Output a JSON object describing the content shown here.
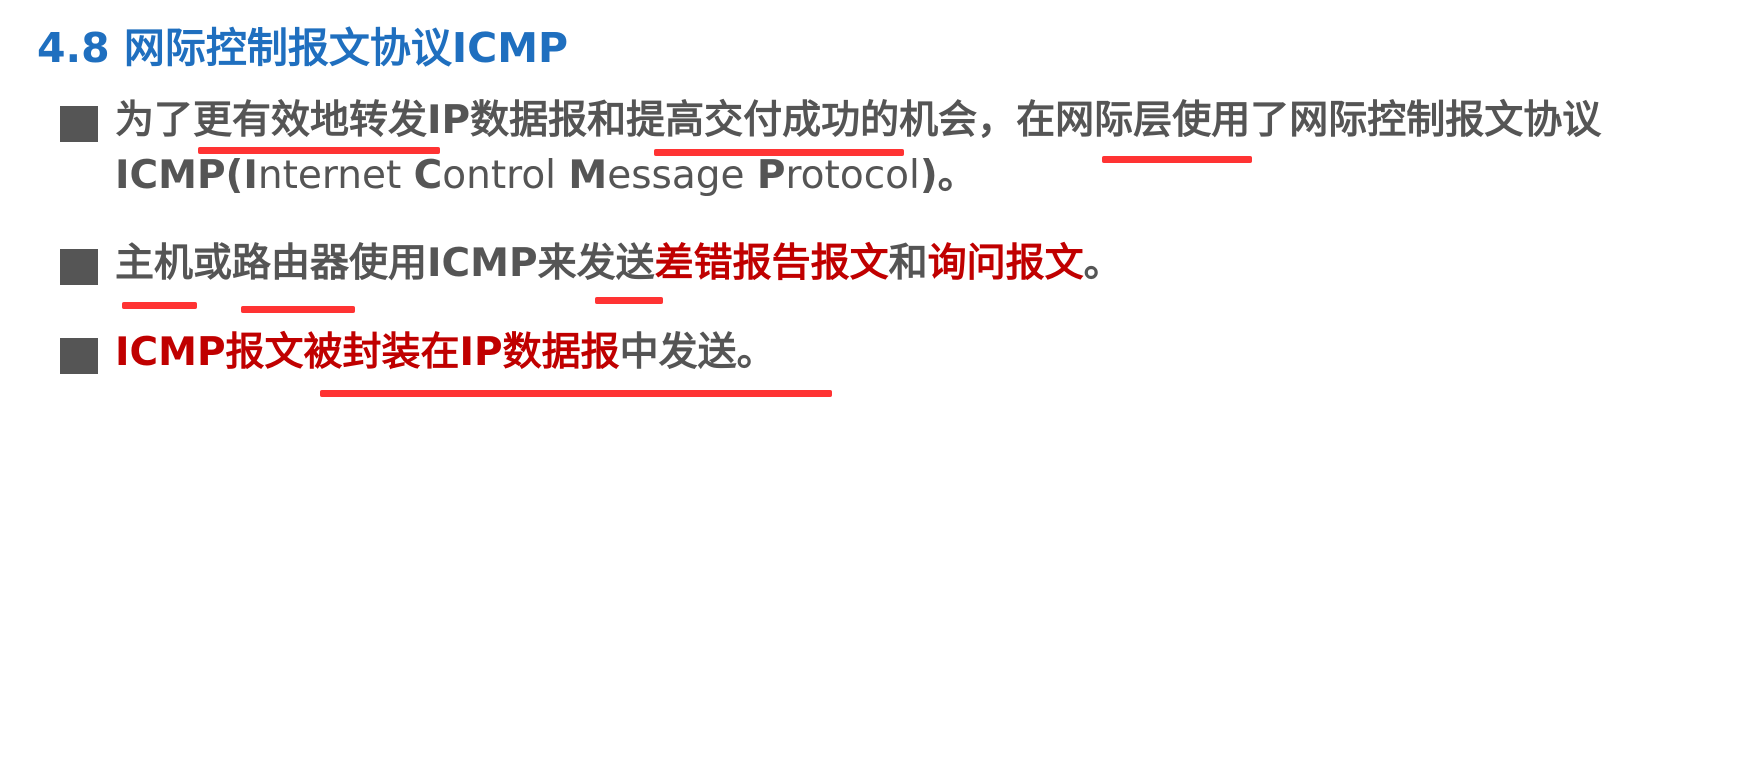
{
  "title": "4.8 网际控制报文协议ICMP",
  "b1": {
    "s1": "为了",
    "s2": "更有效地转发",
    "s3": "IP数据报和",
    "s4": "提高交付成功",
    "s5": "的机会，在",
    "s6": "网际层",
    "s7": "使用了网际控制报文协议",
    "l2a": "ICMP(",
    "l2b": "I",
    "l2c": "nternet ",
    "l2d": "C",
    "l2e": "ontrol ",
    "l2f": "M",
    "l2g": "essage ",
    "l2h": "P",
    "l2i": "rotocol",
    "l2j": ")。"
  },
  "b2": {
    "s1": "主机",
    "s2": "或",
    "s3": "路由器",
    "s4": "使用ICMP来",
    "s5": "发送",
    "s6": "差错报告报文",
    "s7": "和",
    "s8": "询问报文",
    "s9": "。"
  },
  "b3": {
    "s1": "ICMP报文",
    "s2": "被封装在IP数据报",
    "s3": "中发送。"
  },
  "colors": {
    "title": "#1f6fbf",
    "text": "#555555",
    "emphasis": "#c00000",
    "underline": "#ff3333"
  }
}
